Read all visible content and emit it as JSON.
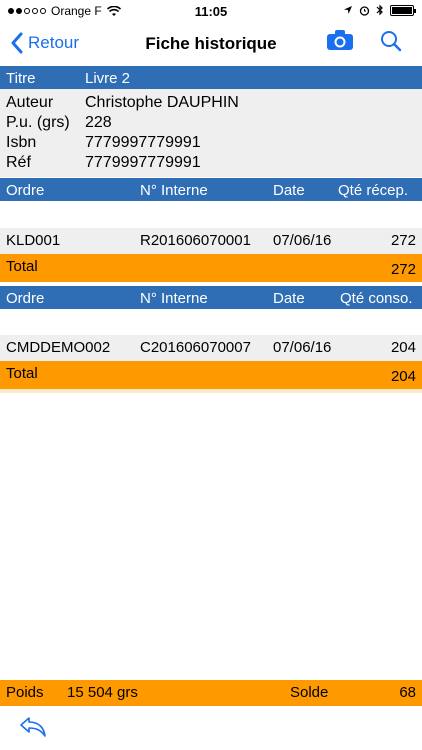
{
  "status": {
    "carrier": "Orange F",
    "time": "11:05"
  },
  "nav": {
    "back_label": "Retour",
    "title": "Fiche historique"
  },
  "book": {
    "title_label": "Titre",
    "title_value": "Livre 2",
    "fields": [
      {
        "label": "Auteur",
        "value": "Christophe DAUPHIN"
      },
      {
        "label": "P.u. (grs)",
        "value": "228"
      },
      {
        "label": "Isbn",
        "value": "7779997779991"
      },
      {
        "label": "Réf",
        "value": "7779997779991"
      }
    ]
  },
  "receptions": {
    "headers": {
      "ordre": "Ordre",
      "interne": "N° Interne",
      "date": "Date",
      "qte": "Qté récep."
    },
    "rows": [
      {
        "ordre": "KLD001",
        "interne": "R201606070001",
        "date": "07/06/16",
        "qte": "272"
      }
    ],
    "total_label": "Total",
    "total_value": "272"
  },
  "consommations": {
    "headers": {
      "ordre": "Ordre",
      "interne": "N° Interne",
      "date": "Date",
      "qte": "Qté conso."
    },
    "rows": [
      {
        "ordre": "CMDDEMO002",
        "interne": "C201606070007",
        "date": "07/06/16",
        "qte": "204"
      }
    ],
    "total_label": "Total",
    "total_value": "204"
  },
  "footer": {
    "poids_label": "Poids",
    "poids_value": "15 504 grs",
    "solde_label": "Solde",
    "solde_value": "68"
  },
  "colors": {
    "blue_header": "#2f6db5",
    "orange": "#ff9900",
    "accent": "#1a6ff0",
    "gray_row": "#efefef"
  },
  "icons": {
    "back": "chevron-left-icon",
    "camera": "camera-icon",
    "search": "search-icon",
    "undo": "undo-icon"
  }
}
